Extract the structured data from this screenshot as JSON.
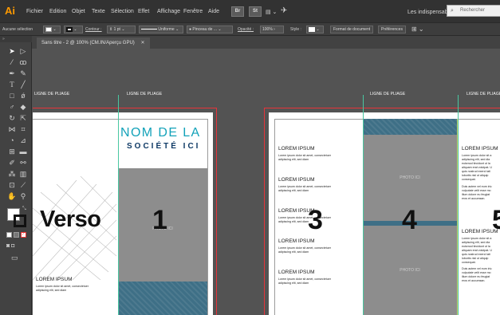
{
  "app": {
    "logo": "Ai",
    "menu": [
      "Fichier",
      "Edition",
      "Objet",
      "Texte",
      "Sélection",
      "Effet",
      "Affichage",
      "Fenêtre",
      "Aide"
    ],
    "tiles": [
      "Br",
      "St"
    ],
    "workspace": "Les indispensables",
    "search_placeholder": "Rechercher"
  },
  "control": {
    "selection_state": "Aucune sélection",
    "stroke_label": "Contour :",
    "stroke_value": "1 pt",
    "profile": "Uniforme",
    "brush": "Pinceau de ...",
    "opacity_label": "Opacité :",
    "opacity_value": "100%",
    "style_label": "Style :",
    "doc_button": "Format de document",
    "prefs_button": "Préférences"
  },
  "document": {
    "tab_title": "Sans titre - 2 @ 100% (CM.IN/Aperçu GPU)",
    "close_glyph": "✕"
  },
  "tools": {
    "icons": [
      "selection-icon",
      "direct-selection-icon",
      "magic-wand-icon",
      "lasso-icon",
      "pen-icon",
      "curvature-icon",
      "type-icon",
      "line-icon",
      "rectangle-icon",
      "paintbrush-icon",
      "shaper-icon",
      "eraser-icon",
      "rotate-icon",
      "scale-icon",
      "width-icon",
      "free-transform-icon",
      "shape-builder-icon",
      "perspective-icon",
      "mesh-icon",
      "gradient-icon",
      "eyedropper-icon",
      "blend-icon",
      "symbol-sprayer-icon",
      "graph-icon",
      "artboard-icon",
      "slice-icon",
      "hand-icon",
      "zoom-icon"
    ]
  },
  "canvas": {
    "fold_label": "LIGNE DE PLIAGE",
    "verso": "Verso",
    "company_line1": "NOM DE LA",
    "company_line2": "SOCIÉTÉ ICI",
    "photo_label": "PHOTO ICI",
    "numbers": [
      "1",
      "3",
      "4",
      "5"
    ],
    "lorem_title": "LOREM IPSUM",
    "lorem_short": [
      "Lorem ipsum dolor sit amet, consectetuer",
      "adipiscing elit, sed diam"
    ],
    "lorem_long": [
      "Lorem ipsum dolor sit a",
      "adipiscing elit, sed dia",
      "euismod tincidunt ut la",
      "aliquam erat volutpat. U",
      "quis nostrud exerci tati",
      "lobortis nisl ut aliquip",
      "consequat."
    ],
    "lorem_long2": [
      "Duis autem vel eum iriu",
      "vulputate velit esse mo",
      "illum dolore eu feugiat",
      "eros et accumsan."
    ],
    "colors": {
      "accent_teal": "#13a2b9",
      "navy": "#0f3a66",
      "artboard_border": "#e8333a",
      "fold_guide": "#49c7a1"
    }
  }
}
